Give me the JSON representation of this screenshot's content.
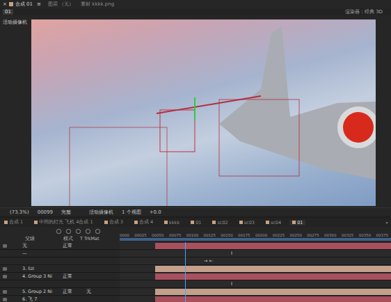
{
  "top_tabs": [
    {
      "label": "合成 01",
      "selected": true,
      "close": "×",
      "menu": "≡"
    },
    {
      "label": "图层 （无）",
      "selected": false,
      "close": "",
      "menu": ""
    },
    {
      "label": "素材 kkkk.png",
      "selected": false,
      "close": "",
      "menu": ""
    }
  ],
  "viewer": {
    "comp_tag": "01",
    "renderer": "渲染器：经典 3D",
    "camera_label": "活动摄像机"
  },
  "viewer_footer": {
    "zoom": "(73.3%)",
    "timecode": "00099",
    "resolution": "完整",
    "camera": "活动摄像机",
    "views": "1 个视图",
    "exposure": "+0.0"
  },
  "timeline_tabs": [
    {
      "label": "合成 1",
      "selected": false
    },
    {
      "label": "中间的灯光 飞机 4合成 1",
      "selected": false
    },
    {
      "label": "合成 3",
      "selected": false
    },
    {
      "label": "合成 4",
      "selected": false
    },
    {
      "label": "kkkk",
      "selected": false
    },
    {
      "label": "01",
      "selected": false
    },
    {
      "label": "sc02",
      "selected": false
    },
    {
      "label": "sc03",
      "selected": false
    },
    {
      "label": "sc04",
      "selected": false
    },
    {
      "label": "01",
      "selected": true
    }
  ],
  "timeline_more": "»",
  "columns": {
    "parent": "父级",
    "mode": "模式",
    "trkmat": "T TrkMat"
  },
  "ruler": [
    "0000",
    "00025",
    "00050",
    "00075",
    "00100",
    "00125",
    "00150",
    "00175",
    "00200",
    "00225",
    "00250",
    "00275",
    "00300",
    "00325",
    "00350",
    "00375"
  ],
  "playhead": 0.24,
  "layers": [
    {
      "kind": "bar",
      "label": "无",
      "mode": "正常",
      "parent": "",
      "color": "#a8505e",
      "start": 0.13,
      "mark": "",
      "at": 0
    },
    {
      "kind": "marker",
      "label": "—",
      "mode": "",
      "parent": "",
      "color": "",
      "start": 0,
      "mark": "I",
      "at": 0.41
    },
    {
      "kind": "marker",
      "label": "",
      "mode": "",
      "parent": "",
      "color": "",
      "start": 0,
      "mark": "→ ←",
      "at": 0.31
    },
    {
      "kind": "bar",
      "label": "3. lizi",
      "mode": "",
      "parent": "",
      "color": "#c4a08c",
      "start": 0.13,
      "mark": "",
      "at": 0
    },
    {
      "kind": "bar",
      "label": "4. Group 3 Ni",
      "mode": "正常",
      "parent": "",
      "color": "#a8505e",
      "start": 0.13,
      "mark": "",
      "at": 0
    },
    {
      "kind": "marker",
      "label": "",
      "mode": "",
      "parent": "",
      "color": "",
      "start": 0,
      "mark": "I",
      "at": 0.41
    },
    {
      "kind": "bar",
      "label": "5. Group 2 Ni",
      "mode": "正常",
      "parent": "无",
      "color": "#c4a08c",
      "start": 0.13,
      "mark": "",
      "at": 0
    },
    {
      "kind": "bar",
      "label": "6. 飞 7",
      "mode": "",
      "parent": "",
      "color": "#a8505e",
      "start": 0.13,
      "mark": "",
      "at": 0
    }
  ]
}
